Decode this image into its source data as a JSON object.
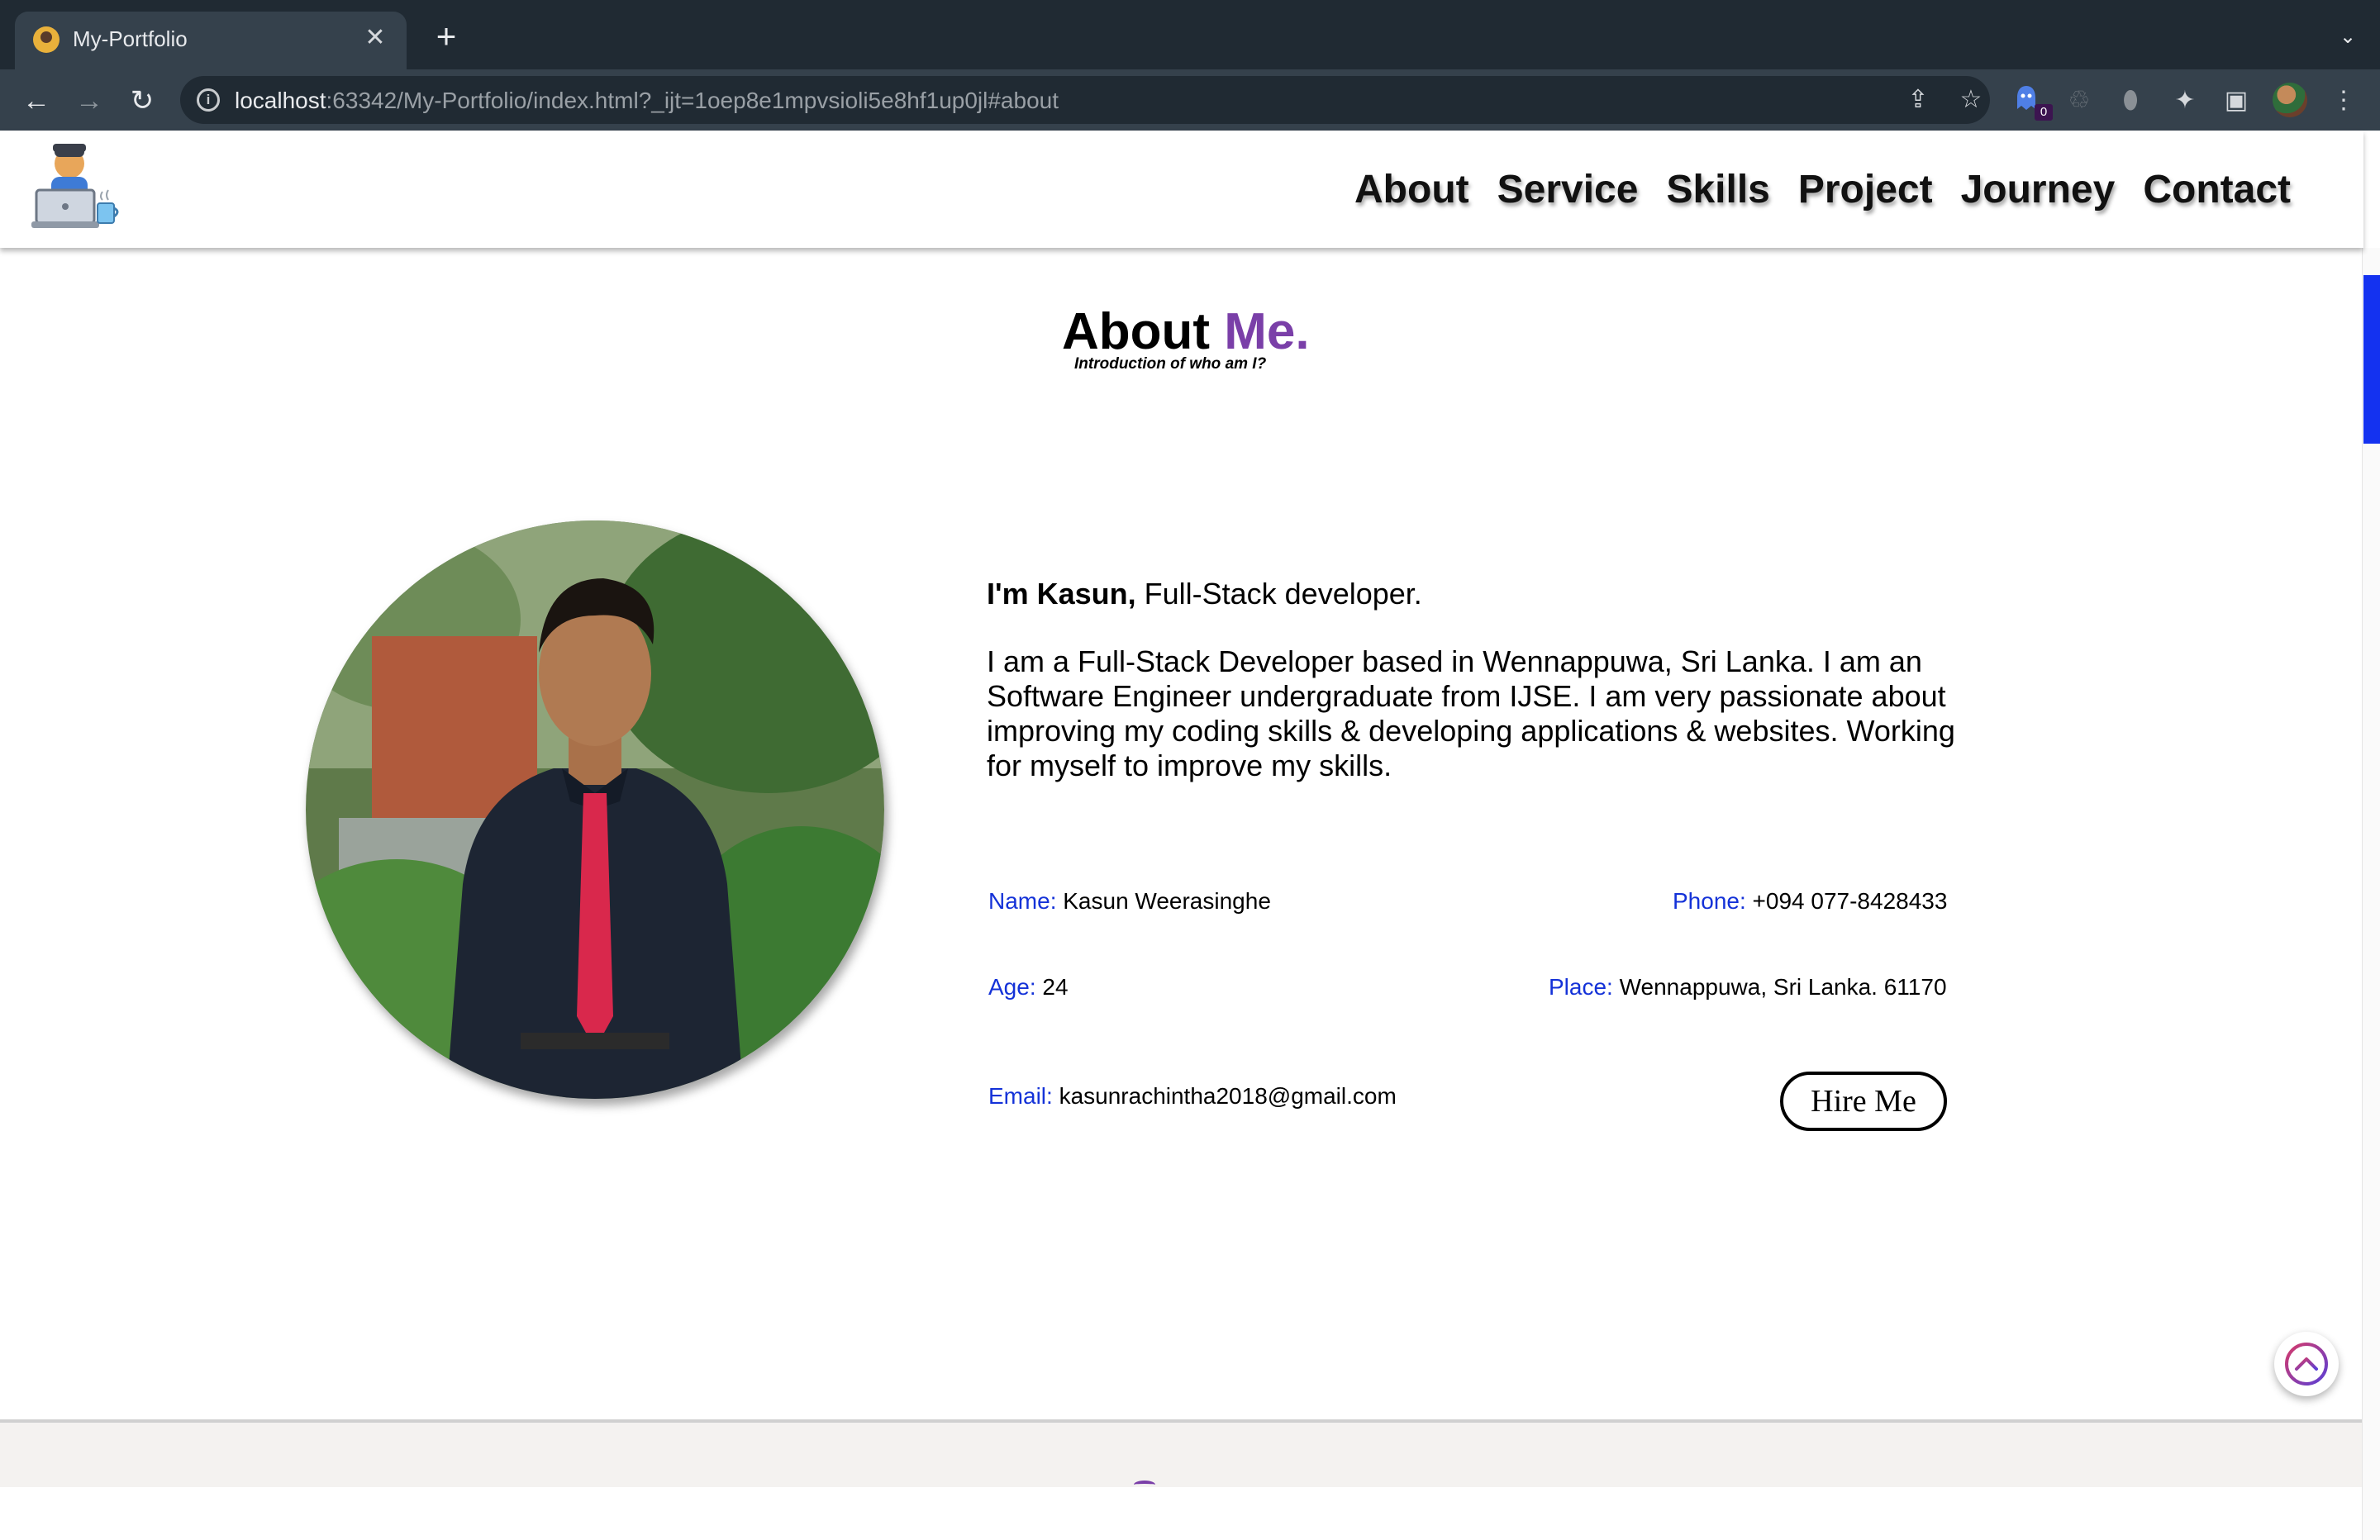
{
  "browser": {
    "tab_title": "My-Portfolio",
    "tab_close": "✕",
    "new_tab": "+",
    "tab_search": "⌄",
    "url_host": "localhost",
    "url_rest": ":63342/My-Portfolio/index.html?_ijt=1oep8e1mpvsioli5e8hf1up0jl#about",
    "back": "←",
    "forward": "→",
    "reload": "↻",
    "info": "i",
    "share": "⇪",
    "star": "☆",
    "extension_badge": "0",
    "extensions": "✦",
    "sidepanel": "▣",
    "menu": "⋮"
  },
  "nav": {
    "items": [
      "About",
      "Service",
      "Skills",
      "Project",
      "Journey",
      "Contact"
    ]
  },
  "about": {
    "title_main": "About",
    "title_accent": "Me.",
    "subtitle": "Introduction of who am I?",
    "intro_bold": "I'm Kasun,",
    "intro_rest": " Full-Stack developer.",
    "bio": "I am a Full-Stack Developer based in Wennappuwa, Sri Lanka. I am an Software Engineer undergraduate from IJSE. I am very passionate about improving my coding skills & developing applications & websites. Working for myself to improve my skills.",
    "fields": {
      "name_key": "Name:",
      "name_value": " Kasun Weerasinghe",
      "phone_key": "Phone:",
      "phone_value": " +094 077-8428433",
      "age_key": "Age:",
      "age_value": " 24",
      "place_key": "Place:",
      "place_value": " Wennappuwa, Sri Lanka. 61170",
      "email_key": "Email:",
      "email_value": " kasunrachintha2018@gmail.com"
    },
    "hire_button": "Hire Me"
  },
  "colors": {
    "accent_purple": "#7a3fa8",
    "field_key_blue": "#1432d8",
    "scrollbar_blue": "#1432f0"
  }
}
